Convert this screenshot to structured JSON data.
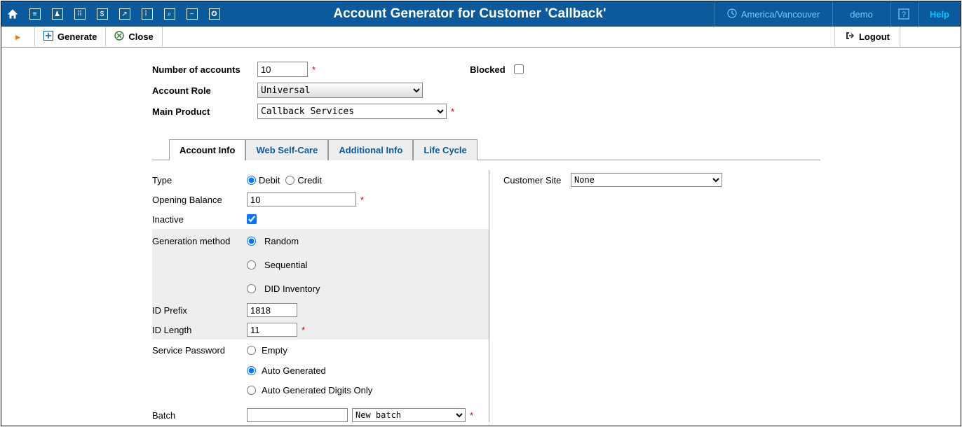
{
  "header": {
    "title": "Account Generator for Customer 'Callback'",
    "timezone": "America/Vancouver",
    "user": "demo",
    "help": "Help"
  },
  "toolbar": {
    "generate": "Generate",
    "close": "Close",
    "logout": "Logout"
  },
  "form": {
    "num_accounts_label": "Number of accounts",
    "num_accounts_value": "10",
    "blocked_label": "Blocked",
    "account_role_label": "Account Role",
    "account_role_value": "Universal",
    "main_product_label": "Main Product",
    "main_product_value": "Callback Services"
  },
  "tabs": {
    "account_info": "Account Info",
    "web_self_care": "Web Self-Care",
    "additional_info": "Additional Info",
    "life_cycle": "Life Cycle"
  },
  "account_info": {
    "type_label": "Type",
    "type_debit": "Debit",
    "type_credit": "Credit",
    "opening_balance_label": "Opening Balance",
    "opening_balance_value": "10",
    "inactive_label": "Inactive",
    "gen_method_label": "Generation method",
    "gen_random": "Random",
    "gen_sequential": "Sequential",
    "gen_did": "DID Inventory",
    "id_prefix_label": "ID Prefix",
    "id_prefix_value": "1818",
    "id_length_label": "ID Length",
    "id_length_value": "11",
    "service_pw_label": "Service Password",
    "pw_empty": "Empty",
    "pw_auto": "Auto Generated",
    "pw_auto_digits": "Auto Generated Digits Only",
    "batch_label": "Batch",
    "batch_value": "",
    "batch_select": "New batch",
    "customer_site_label": "Customer Site",
    "customer_site_value": "None"
  }
}
